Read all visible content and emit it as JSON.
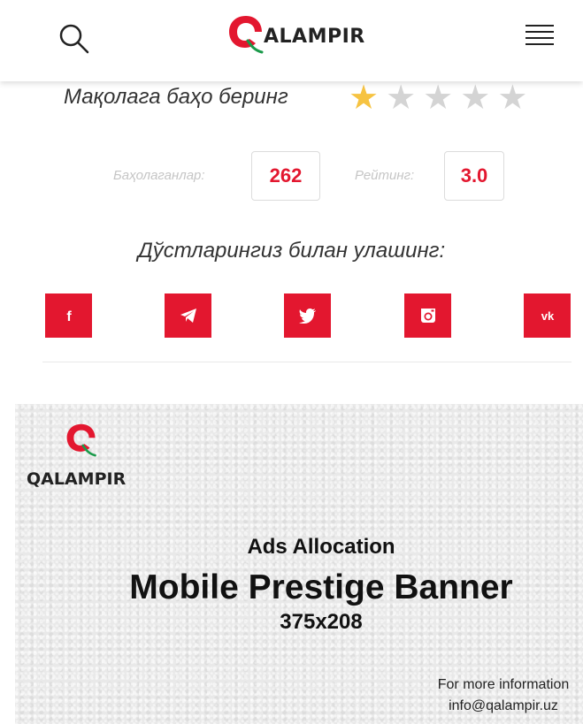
{
  "header": {
    "logo_text": "ALAMPIR",
    "icons": {
      "search": "search-icon",
      "menu": "hamburger-menu-icon"
    }
  },
  "rating": {
    "prompt": "Мақолага баҳо беринг",
    "stars_filled": 1,
    "stars_total": 5,
    "colors": {
      "filled": "#f6c342",
      "empty": "#d4d4d4"
    },
    "raters_label": "Баҳолаганлар:",
    "raters_count": "262",
    "rating_label": "Рейтинг:",
    "rating_value": "3.0"
  },
  "share": {
    "title": "Дўстларингиз билан улашинг:",
    "networks": [
      "facebook",
      "telegram",
      "twitter",
      "instagram",
      "vk"
    ],
    "accent": "#e3172f"
  },
  "banner": {
    "logo_text": "QALAMPIR",
    "ads_label": "Ads Allocation",
    "title": "Mobile Prestige Banner",
    "size": "375x208",
    "info_line1": "For more information",
    "info_line2": "info@qalampir.uz"
  }
}
